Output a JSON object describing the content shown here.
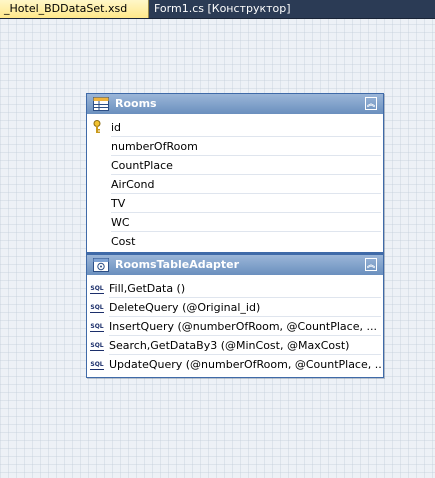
{
  "tabs": [
    {
      "label": "_Hotel_BDDataSet.xsd",
      "active": true
    },
    {
      "label": "Form1.cs [Конструктор]",
      "active": false
    }
  ],
  "table": {
    "title": "Rooms",
    "icon": "table-icon",
    "columns": [
      {
        "name": "id",
        "is_key": true
      },
      {
        "name": "numberOfRoom",
        "is_key": false
      },
      {
        "name": "CountPlace",
        "is_key": false
      },
      {
        "name": "AirCond",
        "is_key": false
      },
      {
        "name": "TV",
        "is_key": false
      },
      {
        "name": "WC",
        "is_key": false
      },
      {
        "name": "Cost",
        "is_key": false
      }
    ]
  },
  "adapter": {
    "title": "RoomsTableAdapter",
    "icon": "table-adapter-icon",
    "queries": [
      "Fill,GetData ()",
      "DeleteQuery (@Original_id)",
      "InsertQuery (@numberOfRoom, @CountPlace, ...",
      "Search,GetDataBy3 (@MinCost, @MaxCost)",
      "UpdateQuery (@numberOfRoom, @CountPlace, ..."
    ],
    "query_icon_text": "SQL"
  },
  "collapse_glyph": "︽",
  "colors": {
    "header_blue": "#6a8fbe",
    "border_blue": "#3f6aa8",
    "tab_active": "#ffe88a",
    "tabbar": "#2b3b55"
  }
}
